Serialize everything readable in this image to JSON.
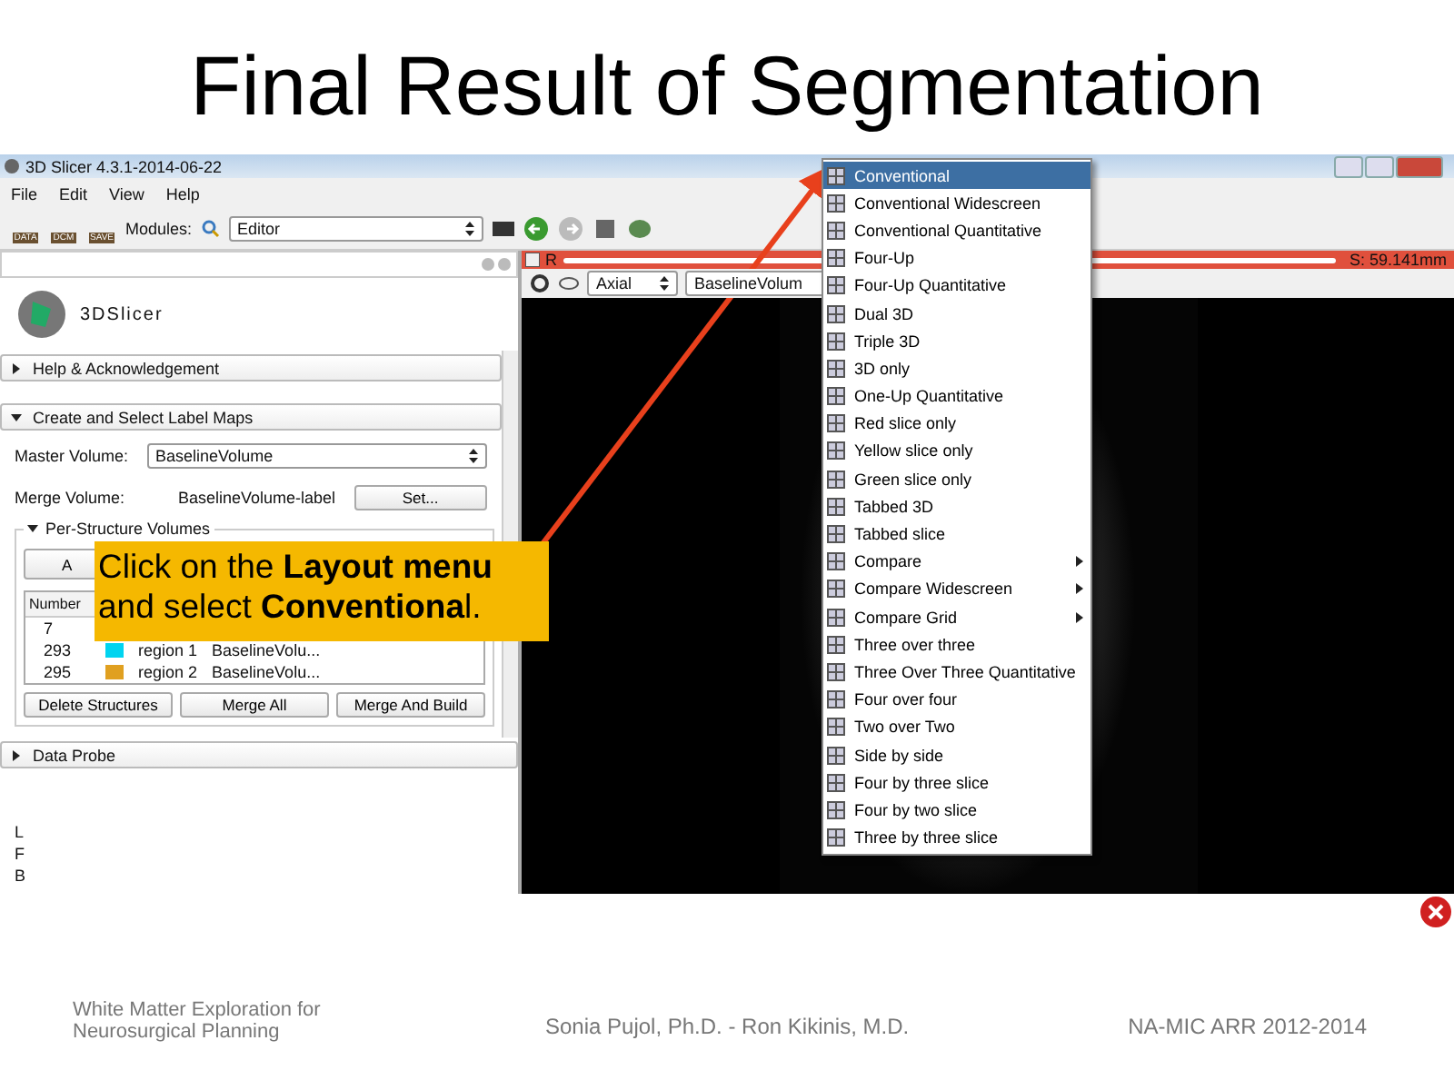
{
  "slide_title": "Final Result of Segmentation",
  "window": {
    "title": "3D Slicer 4.3.1-2014-06-22"
  },
  "menu_bar": [
    "File",
    "Edit",
    "View",
    "Help"
  ],
  "toolbar": {
    "buttons": [
      "DATA",
      "DCM",
      "SAVE"
    ],
    "modules_label": "Modules:",
    "module": "Editor"
  },
  "logo_text": "3DSlicer",
  "help_section": {
    "label": "Help & Acknowledgement",
    "expanded": false
  },
  "label_maps": {
    "label": "Create and Select Label Maps",
    "expanded": true,
    "master_label": "Master Volume:",
    "master_value": "BaselineVolume",
    "merge_label": "Merge Volume:",
    "merge_value": "BaselineVolume-label",
    "set_button": "Set..."
  },
  "per_structure": {
    "label": "Per-Structure Volumes",
    "expanded": true,
    "add_button": "A",
    "number_header": "Number",
    "rows": [
      {
        "number": "7"
      },
      {
        "number": "293",
        "color": "#00d4f0",
        "name": "region 1",
        "volume": "BaselineVolu..."
      },
      {
        "number": "295",
        "color": "#e0a020",
        "name": "region 2",
        "volume": "BaselineVolu..."
      }
    ],
    "buttons": [
      "Delete Structures",
      "Merge All",
      "Merge And Build"
    ]
  },
  "data_probe": {
    "label": "Data Probe",
    "expanded": false,
    "lines": [
      "L",
      "F",
      "B"
    ]
  },
  "slice_view": {
    "label": "R",
    "level": 1,
    "offset": "S: 59.141mm",
    "orientation": "Axial",
    "volume": "BaselineVolum"
  },
  "layout_menu": [
    {
      "label": "Conventional",
      "selected": true,
      "submenu": false
    },
    {
      "label": "Conventional Widescreen",
      "selected": false,
      "submenu": false
    },
    {
      "label": "Conventional Quantitative",
      "selected": false,
      "submenu": false
    },
    {
      "label": "Four-Up",
      "selected": false,
      "submenu": false
    },
    {
      "label": "Four-Up Quantitative",
      "selected": false,
      "submenu": false
    },
    {
      "label": "Dual 3D",
      "selected": false,
      "submenu": false
    },
    {
      "label": "Triple 3D",
      "selected": false,
      "submenu": false
    },
    {
      "label": "3D only",
      "selected": false,
      "submenu": false
    },
    {
      "label": "One-Up Quantitative",
      "selected": false,
      "submenu": false
    },
    {
      "label": "Red slice only",
      "selected": false,
      "submenu": false
    },
    {
      "label": "Yellow slice only",
      "selected": false,
      "submenu": false
    },
    {
      "label": "Green slice only",
      "selected": false,
      "submenu": false
    },
    {
      "label": "Tabbed 3D",
      "selected": false,
      "submenu": false
    },
    {
      "label": "Tabbed slice",
      "selected": false,
      "submenu": false
    },
    {
      "label": "Compare",
      "selected": false,
      "submenu": true
    },
    {
      "label": "Compare Widescreen",
      "selected": false,
      "submenu": true
    },
    {
      "label": "Compare Grid",
      "selected": false,
      "submenu": true
    },
    {
      "label": "Three over three",
      "selected": false,
      "submenu": false
    },
    {
      "label": "Three Over Three Quantitative",
      "selected": false,
      "submenu": false
    },
    {
      "label": "Four over four",
      "selected": false,
      "submenu": false
    },
    {
      "label": "Two over Two",
      "selected": false,
      "submenu": false
    },
    {
      "label": "Side by side",
      "selected": false,
      "submenu": false
    },
    {
      "label": "Four by three slice",
      "selected": false,
      "submenu": false
    },
    {
      "label": "Four by two slice",
      "selected": false,
      "submenu": false
    },
    {
      "label": "Three by three slice",
      "selected": false,
      "submenu": false
    }
  ],
  "callout": "Click on the **Layout menu** and select **Conventiona**l.",
  "footer": [
    "White Matter Exploration for Neurosurgical Planning",
    "Sonia Pujol, Ph.D. - Ron Kikinis, M.D.",
    "NA-MIC ARR 2012-2014"
  ]
}
